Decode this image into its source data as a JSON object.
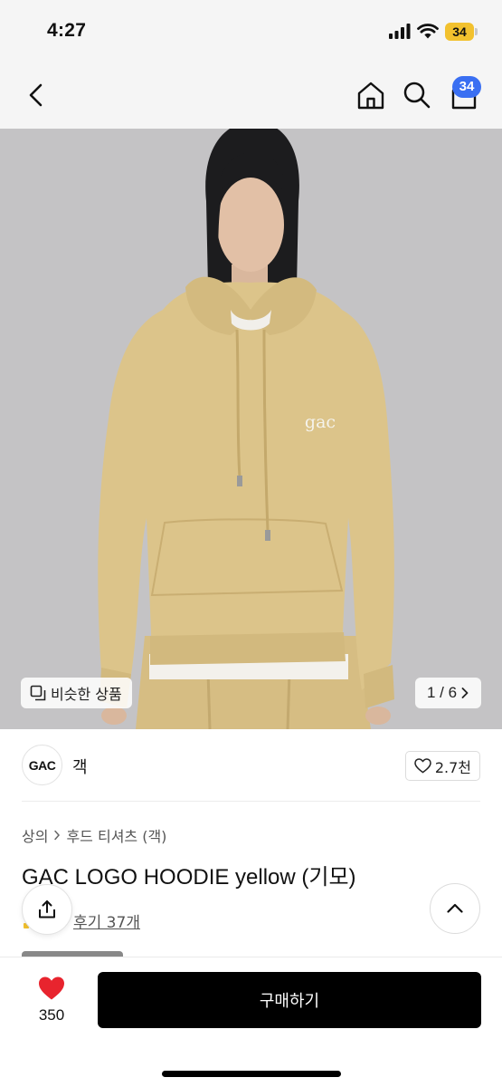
{
  "status_bar": {
    "time": "4:27",
    "battery": "34"
  },
  "nav": {
    "cart_badge": "34"
  },
  "gallery": {
    "similar_label": "비슷한 상품",
    "counter": "1 / 6",
    "chest_print": "gac",
    "colors": {
      "background": "#c4c3c5",
      "hoodie": "#dcc48a",
      "hair": "#1c1c1e"
    }
  },
  "shop": {
    "logo_text": "GAC",
    "name": "객",
    "likes": "2.7천"
  },
  "product": {
    "breadcrumb": [
      "상의",
      "후드 티셔츠 (객)"
    ],
    "title": "GAC LOGO HOODIE yellow (기모)",
    "reviews": "후기 37개"
  },
  "bottom_bar": {
    "wish_count": "350",
    "buy_label": "구매하기"
  },
  "colors": {
    "accent": "#3a6ff2",
    "heart": "#e8242e",
    "buy_button": "#000000"
  },
  "icons": [
    "back-icon",
    "home-icon",
    "search-icon",
    "shopping-bag-icon",
    "copy-icon",
    "chevron-right-icon",
    "heart-outline-icon",
    "share-icon",
    "chevron-up-icon",
    "heart-filled-icon"
  ]
}
